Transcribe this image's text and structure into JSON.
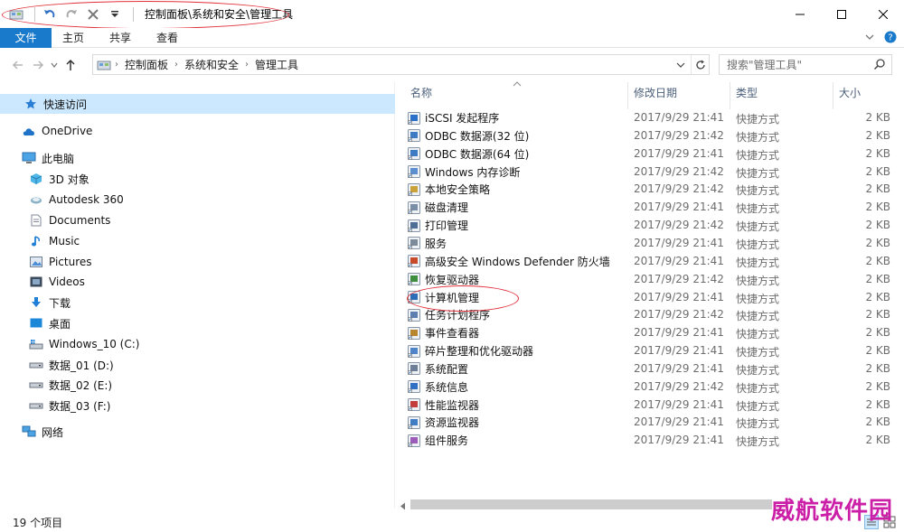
{
  "window": {
    "title": "控制面板\\系统和安全\\管理工具"
  },
  "ribbon": {
    "tabs": [
      "文件",
      "主页",
      "共享",
      "查看"
    ]
  },
  "address": {
    "crumbs": [
      "控制面板",
      "系统和安全",
      "管理工具"
    ],
    "search_placeholder": "搜索\"管理工具\""
  },
  "nav": {
    "quick_access": "快速访问",
    "onedrive": "OneDrive",
    "this_pc": "此电脑",
    "items": [
      "3D 对象",
      "Autodesk 360",
      "Documents",
      "Music",
      "Pictures",
      "Videos",
      "下载",
      "桌面",
      "Windows_10 (C:)",
      "数据_01 (D:)",
      "数据_02 (E:)",
      "数据_03 (F:)"
    ],
    "network": "网络"
  },
  "columns": {
    "name": "名称",
    "date": "修改日期",
    "type": "类型",
    "size": "大小"
  },
  "files": [
    {
      "name": "iSCSI 发起程序",
      "date": "2017/9/29 21:41",
      "type": "快捷方式",
      "size": "2 KB",
      "icon": "iscsi-icon"
    },
    {
      "name": "ODBC 数据源(32 位)",
      "date": "2017/9/29 21:42",
      "type": "快捷方式",
      "size": "2 KB",
      "icon": "odbc-icon"
    },
    {
      "name": "ODBC 数据源(64 位)",
      "date": "2017/9/29 21:41",
      "type": "快捷方式",
      "size": "2 KB",
      "icon": "odbc-icon"
    },
    {
      "name": "Windows 内存诊断",
      "date": "2017/9/29 21:42",
      "type": "快捷方式",
      "size": "2 KB",
      "icon": "memory-diagnostic-icon"
    },
    {
      "name": "本地安全策略",
      "date": "2017/9/29 21:42",
      "type": "快捷方式",
      "size": "2 KB",
      "icon": "security-policy-icon"
    },
    {
      "name": "磁盘清理",
      "date": "2017/9/29 21:41",
      "type": "快捷方式",
      "size": "2 KB",
      "icon": "disk-cleanup-icon"
    },
    {
      "name": "打印管理",
      "date": "2017/9/29 21:42",
      "type": "快捷方式",
      "size": "2 KB",
      "icon": "print-management-icon"
    },
    {
      "name": "服务",
      "date": "2017/9/29 21:41",
      "type": "快捷方式",
      "size": "2 KB",
      "icon": "services-icon"
    },
    {
      "name": "高级安全 Windows Defender 防火墙",
      "date": "2017/9/29 21:41",
      "type": "快捷方式",
      "size": "2 KB",
      "icon": "firewall-icon"
    },
    {
      "name": "恢复驱动器",
      "date": "2017/9/29 21:42",
      "type": "快捷方式",
      "size": "2 KB",
      "icon": "recovery-drive-icon"
    },
    {
      "name": "计算机管理",
      "date": "2017/9/29 21:41",
      "type": "快捷方式",
      "size": "2 KB",
      "icon": "computer-management-icon"
    },
    {
      "name": "任务计划程序",
      "date": "2017/9/29 21:42",
      "type": "快捷方式",
      "size": "2 KB",
      "icon": "task-scheduler-icon"
    },
    {
      "name": "事件查看器",
      "date": "2017/9/29 21:41",
      "type": "快捷方式",
      "size": "2 KB",
      "icon": "event-viewer-icon"
    },
    {
      "name": "碎片整理和优化驱动器",
      "date": "2017/9/29 21:41",
      "type": "快捷方式",
      "size": "2 KB",
      "icon": "defrag-icon"
    },
    {
      "name": "系统配置",
      "date": "2017/9/29 21:41",
      "type": "快捷方式",
      "size": "2 KB",
      "icon": "system-config-icon"
    },
    {
      "name": "系统信息",
      "date": "2017/9/29 21:42",
      "type": "快捷方式",
      "size": "2 KB",
      "icon": "system-info-icon"
    },
    {
      "name": "性能监视器",
      "date": "2017/9/29 21:41",
      "type": "快捷方式",
      "size": "2 KB",
      "icon": "performance-monitor-icon"
    },
    {
      "name": "资源监视器",
      "date": "2017/9/29 21:41",
      "type": "快捷方式",
      "size": "2 KB",
      "icon": "resource-monitor-icon"
    },
    {
      "name": "组件服务",
      "date": "2017/9/29 21:41",
      "type": "快捷方式",
      "size": "2 KB",
      "icon": "component-services-icon"
    }
  ],
  "status": {
    "item_count": "19 个项目"
  },
  "watermark": "威航软件园",
  "colors": {
    "accent": "#1979ca",
    "annotation": "#e0303a",
    "selection": "#cce8ff",
    "watermark": "#cc1fa7"
  }
}
